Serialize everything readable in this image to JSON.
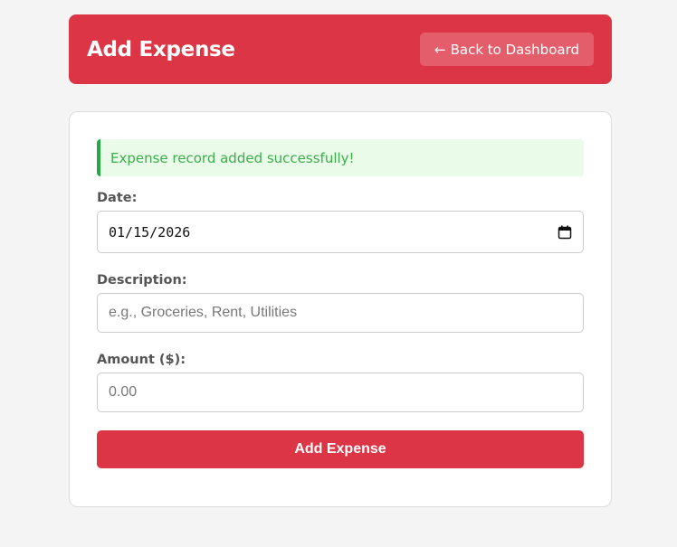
{
  "header": {
    "title": "Add Expense",
    "back_arrow": "←",
    "back_label": "Back to Dashboard"
  },
  "alert": {
    "message": "Expense record added successfully!",
    "type": "success",
    "color": "#3cae4c"
  },
  "form": {
    "date": {
      "label": "Date:",
      "value": "01/15/2026",
      "icon": "calendar-icon"
    },
    "description": {
      "label": "Description:",
      "value": "",
      "placeholder": "e.g., Groceries, Rent, Utilities"
    },
    "amount": {
      "label": "Amount ($):",
      "value": "",
      "placeholder": "0.00"
    },
    "submit_label": "Add Expense"
  },
  "colors": {
    "brand": "#dc3545",
    "background": "#f4f4f4",
    "success": "#28a745"
  }
}
